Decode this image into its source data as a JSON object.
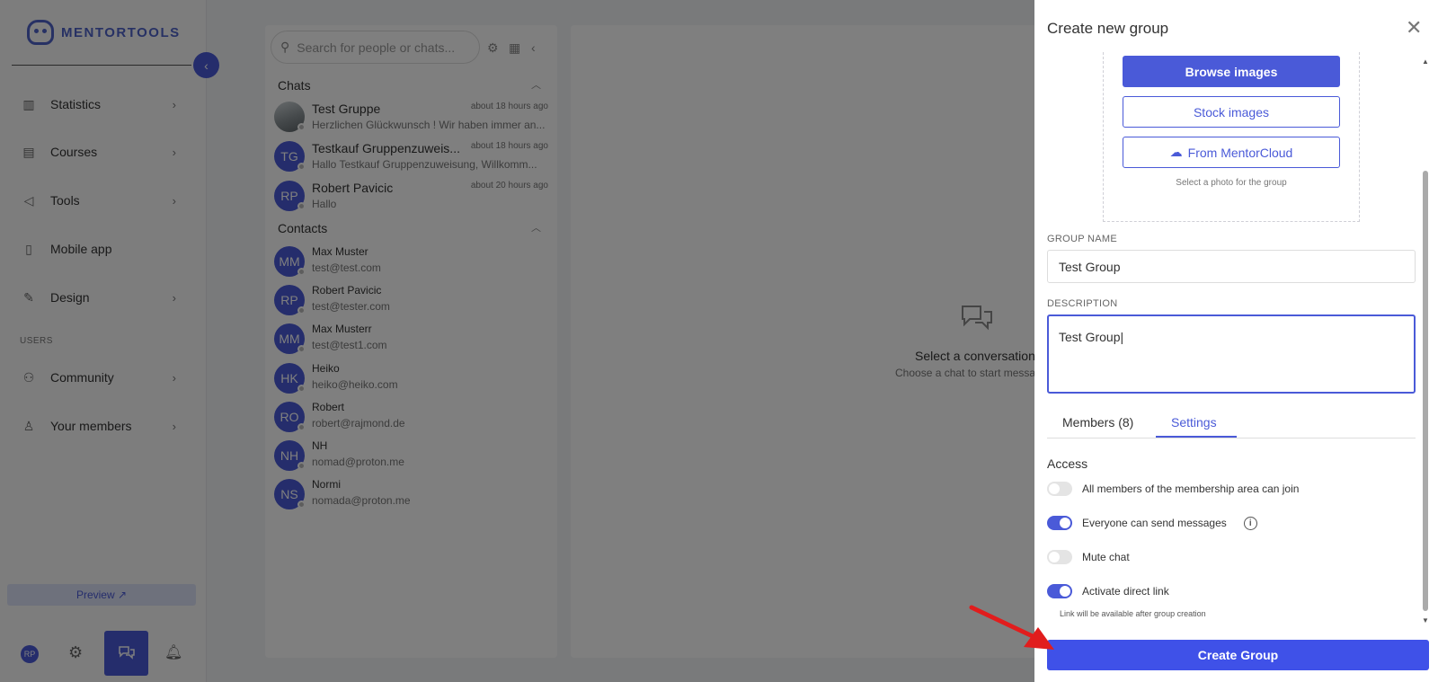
{
  "brand": {
    "name": "MENTORTOOLS"
  },
  "sidebar": {
    "items": [
      {
        "label": "Statistics",
        "icon": "bar-chart-icon"
      },
      {
        "label": "Courses",
        "icon": "book-icon"
      },
      {
        "label": "Tools",
        "icon": "megaphone-icon"
      },
      {
        "label": "Mobile app",
        "icon": "phone-icon"
      },
      {
        "label": "Design",
        "icon": "edit-icon"
      }
    ],
    "users_section": "USERS",
    "user_items": [
      {
        "label": "Community",
        "icon": "people-icon"
      },
      {
        "label": "Your members",
        "icon": "person-icon"
      }
    ],
    "preview": "Preview ↗",
    "user_initials": "RP"
  },
  "chat": {
    "search_placeholder": "Search for people or chats...",
    "chats_heading": "Chats",
    "chats": [
      {
        "name": "Test Gruppe",
        "time": "about 18 hours ago",
        "message": "Herzlichen Glückwunsch ! Wir haben immer an...",
        "initials": ""
      },
      {
        "name": "Testkauf Gruppenzuweis...",
        "time": "about 18 hours ago",
        "message": "Hallo Testkauf Gruppenzuweisung, Willkomm...",
        "initials": "TG"
      },
      {
        "name": "Robert Pavicic",
        "time": "about 20 hours ago",
        "message": "Hallo",
        "initials": "RP"
      }
    ],
    "contacts_heading": "Contacts",
    "contacts": [
      {
        "name": "Max Muster",
        "email": "test@test.com",
        "initials": "MM"
      },
      {
        "name": "Robert Pavicic",
        "email": "test@tester.com",
        "initials": "RP"
      },
      {
        "name": "Max Musterr",
        "email": "test@test1.com",
        "initials": "MM"
      },
      {
        "name": "Heiko",
        "email": "heiko@heiko.com",
        "initials": "HK"
      },
      {
        "name": "Robert",
        "email": "robert@rajmond.de",
        "initials": "RO"
      },
      {
        "name": "NH",
        "email": "nomad@proton.me",
        "initials": "NH"
      },
      {
        "name": "Normi",
        "email": "nomada@proton.me",
        "initials": "NS"
      }
    ]
  },
  "main": {
    "empty_title": "Select a conversation",
    "empty_subtitle": "Choose a chat to start messa"
  },
  "drawer": {
    "title": "Create new group",
    "browse_images": "Browse images",
    "stock_images": "Stock images",
    "from_mentorcloud": "From MentorCloud",
    "photo_hint": "Select a photo for the group",
    "group_name_label": "GROUP NAME",
    "group_name_value": "Test Group",
    "description_label": "DESCRIPTION",
    "description_value": "Test Group",
    "tabs": {
      "members": "Members (8)",
      "settings": "Settings"
    },
    "access_title": "Access",
    "toggles": [
      {
        "label": "All members of the membership area can join",
        "on": false
      },
      {
        "label": "Everyone can send messages",
        "on": true
      },
      {
        "label": "Mute chat",
        "on": false
      },
      {
        "label": "Activate direct link",
        "on": true
      }
    ],
    "link_hint": "Link will be available after group creation",
    "create_button": "Create Group"
  },
  "colors": {
    "accent": "#4a5ad8",
    "annotation_arrow": "#e11d1d"
  }
}
